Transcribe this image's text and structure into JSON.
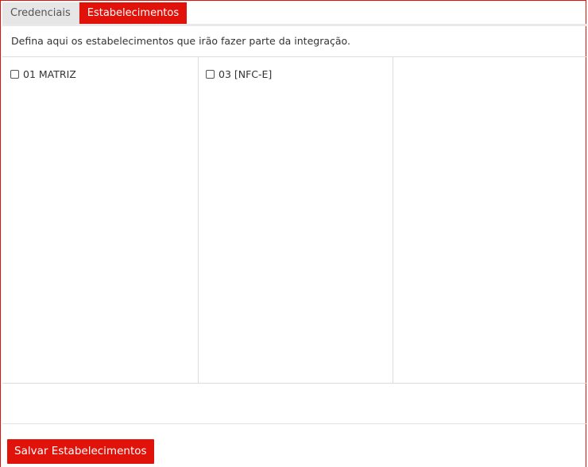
{
  "tabs": [
    {
      "label": "Credenciais",
      "active": false
    },
    {
      "label": "Estabelecimentos",
      "active": true
    }
  ],
  "description": "Defina aqui os estabelecimentos que irão fazer parte da integração.",
  "establishments": [
    {
      "label": "01 MATRIZ",
      "checked": false
    },
    {
      "label": "03 [NFC-E]",
      "checked": false
    }
  ],
  "save_button": "Salvar Estabelecimentos",
  "colors": {
    "accent": "#e0120a",
    "inactive_tab": "#e6e6e6",
    "border": "#dcdcdc"
  }
}
